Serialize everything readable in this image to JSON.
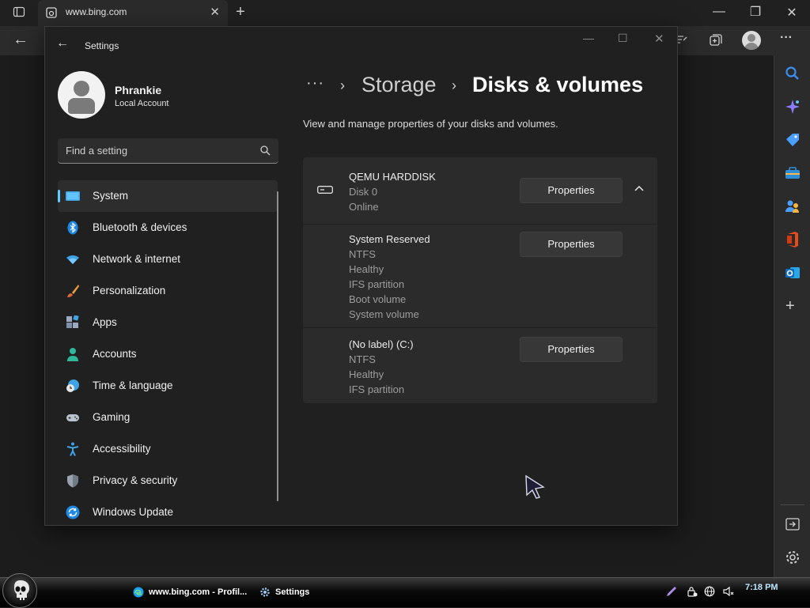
{
  "browser": {
    "tab_title": "www.bing.com",
    "sidebar_icons": [
      "search-icon",
      "copilot-icon",
      "shopping-icon",
      "tools-icon",
      "people-icon",
      "office-icon",
      "outlook-icon",
      "add-icon",
      "split-icon",
      "settings-icon"
    ]
  },
  "settings": {
    "window_title": "Settings",
    "user": {
      "name": "Phrankie",
      "account_type": "Local Account"
    },
    "search": {
      "placeholder": "Find a setting"
    },
    "nav": [
      {
        "label": "System",
        "icon": "system-icon",
        "selected": true
      },
      {
        "label": "Bluetooth & devices",
        "icon": "bluetooth-icon"
      },
      {
        "label": "Network & internet",
        "icon": "wifi-icon"
      },
      {
        "label": "Personalization",
        "icon": "brush-icon"
      },
      {
        "label": "Apps",
        "icon": "apps-icon"
      },
      {
        "label": "Accounts",
        "icon": "accounts-icon"
      },
      {
        "label": "Time & language",
        "icon": "globe-clock-icon"
      },
      {
        "label": "Gaming",
        "icon": "gamepad-icon"
      },
      {
        "label": "Accessibility",
        "icon": "accessibility-icon"
      },
      {
        "label": "Privacy & security",
        "icon": "shield-icon"
      },
      {
        "label": "Windows Update",
        "icon": "update-icon"
      }
    ],
    "breadcrumb": {
      "dots": "···",
      "parent": "Storage",
      "current": "Disks & volumes"
    },
    "description": "View and manage properties of your disks and volumes.",
    "disk": {
      "name": "QEMU HARDDISK",
      "index": "Disk 0",
      "status": "Online",
      "button": "Properties"
    },
    "volumes": [
      {
        "lines": [
          "System Reserved",
          "NTFS",
          "Healthy",
          "IFS partition",
          "Boot volume",
          "System volume"
        ],
        "button": "Properties"
      },
      {
        "lines": [
          "(No label) (C:)",
          "NTFS",
          "Healthy",
          "IFS partition"
        ],
        "button": "Properties"
      }
    ]
  },
  "taskbar": {
    "tasks": [
      {
        "label": "www.bing.com - Profil...",
        "icon": "edge-icon"
      },
      {
        "label": "Settings",
        "icon": "settings-gear-icon"
      }
    ],
    "clock": "7:18 PM"
  }
}
